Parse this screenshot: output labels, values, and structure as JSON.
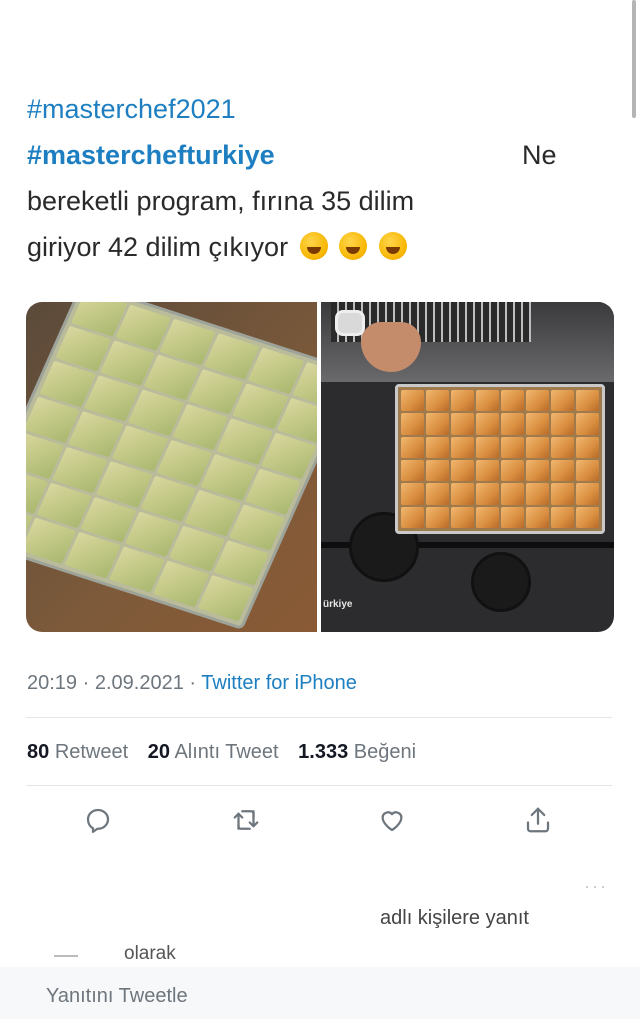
{
  "tweet": {
    "hashtag1": "#masterchef2021",
    "hashtag2": "#masterchefturkiye",
    "text_ne": "Ne",
    "text_line2": "bereketli program, fırına 35 dilim",
    "text_line3": "giriyor 42 dilim çıkıyor",
    "emoji": "rolling-on-floor-laughing-emoji",
    "emoji_count": 3
  },
  "media": {
    "left_image": "green-baklava-tray",
    "right_image": "baked-baklava-tray-on-stove",
    "watermark": "ürkiye"
  },
  "meta": {
    "time": "20:19",
    "separator": "·",
    "date": "2.09.2021",
    "source": "Twitter for iPhone"
  },
  "stats": {
    "retweet_count": "80",
    "retweet_label": "Retweet",
    "quote_count": "20",
    "quote_label": "Alıntı Tweet",
    "like_count": "1.333",
    "like_label": "Beğeni"
  },
  "actions": {
    "reply_icon": "reply-icon",
    "retweet_icon": "retweet-icon",
    "like_icon": "heart-icon",
    "share_icon": "share-icon",
    "more": "···"
  },
  "reply": {
    "reply_to_text": "adlı kişilere yanıt",
    "olarak": "olarak",
    "placeholder": "Yanıtını Tweetle"
  },
  "colors": {
    "link": "#1d7fc1",
    "muted": "#6e767d",
    "text": "#141823"
  }
}
